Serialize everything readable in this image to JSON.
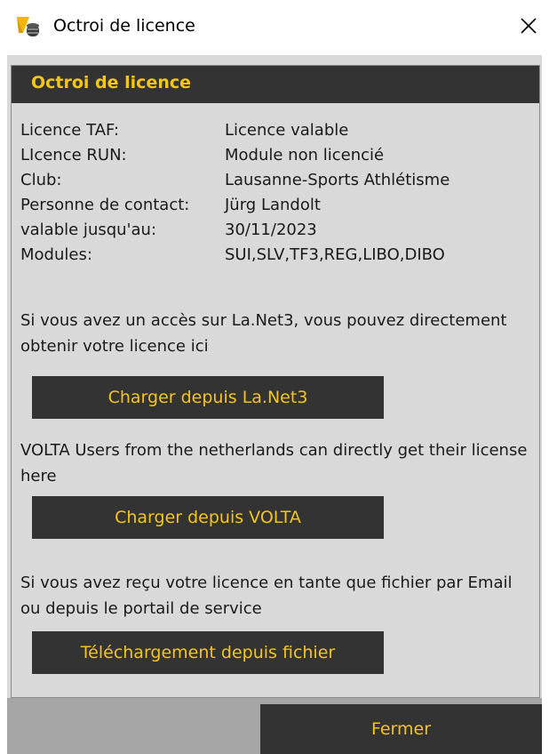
{
  "window": {
    "title": "Octroi de licence",
    "close_glyph": "✕"
  },
  "panel": {
    "header": "Octroi de licence",
    "info": [
      {
        "label": "Licence TAF:",
        "value": "Licence valable"
      },
      {
        "label": "LIcence RUN:",
        "value": "Module non licencié"
      },
      {
        "label": "Club:",
        "value": "Lausanne-Sports Athlétisme"
      },
      {
        "label": "Personne de contact:",
        "value": "Jürg Landolt"
      },
      {
        "label": "valable jusqu'au:",
        "value": "30/11/2023"
      },
      {
        "label": "Modules:",
        "value": "SUI,SLV,TF3,REG,LIBO,DIBO"
      }
    ],
    "lanet_text": "Si vous avez un accès sur La.Net3, vous pouvez directement obtenir votre licence ici",
    "lanet_button": "Charger depuis La.Net3",
    "volta_text": "VOLTA Users from the netherlands can directly get their license here",
    "volta_button": "Charger depuis VOLTA",
    "file_text": "Si vous avez reçu votre licence en tante que fichier par Email ou depuis le portail de service",
    "file_button": "Téléchargement depuis fichier"
  },
  "footer": {
    "close_button": "Fermer"
  },
  "colors": {
    "accent": "#f5c518",
    "dark": "#333333",
    "panel_bg": "#d9d9d9",
    "footer_bg": "#a6a6a6"
  },
  "icons": {
    "app": "app-logo-icon",
    "close": "close-icon"
  }
}
